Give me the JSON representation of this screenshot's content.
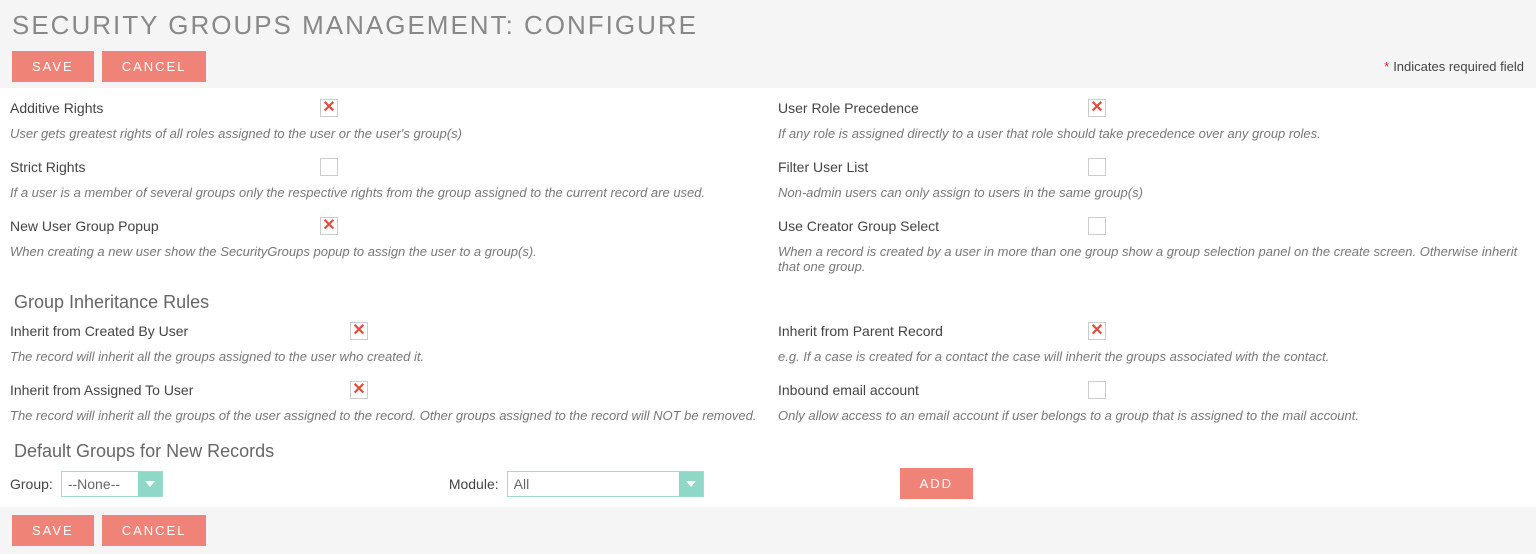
{
  "header": {
    "title": "SECURITY GROUPS MANAGEMENT: CONFIGURE",
    "save": "SAVE",
    "cancel": "CANCEL",
    "required_note": "Indicates required field"
  },
  "left": {
    "additive": {
      "label": "Additive Rights",
      "checked": true,
      "desc": "User gets greatest rights of all roles assigned to the user or the user's group(s)"
    },
    "strict": {
      "label": "Strict Rights",
      "checked": false,
      "desc": "If a user is a member of several groups only the respective rights from the group assigned to the current record are used."
    },
    "popup": {
      "label": "New User Group Popup",
      "checked": true,
      "desc": "When creating a new user show the SecurityGroups popup to assign the user to a group(s)."
    }
  },
  "right": {
    "precedence": {
      "label": "User Role Precedence",
      "checked": true,
      "desc": "If any role is assigned directly to a user that role should take precedence over any group roles."
    },
    "filter": {
      "label": "Filter User List",
      "checked": false,
      "desc": "Non-admin users can only assign to users in the same group(s)"
    },
    "creator": {
      "label": "Use Creator Group Select",
      "checked": false,
      "desc": "When a record is created by a user in more than one group show a group selection panel on the create screen. Otherwise inherit that one group."
    }
  },
  "inherit_title": "Group Inheritance Rules",
  "inherit_left": {
    "created": {
      "label": "Inherit from Created By User",
      "checked": true,
      "desc": "The record will inherit all the groups assigned to the user who created it."
    },
    "assigned": {
      "label": "Inherit from Assigned To User",
      "checked": true,
      "desc": "The record will inherit all the groups of the user assigned to the record. Other groups assigned to the record will NOT be removed."
    }
  },
  "inherit_right": {
    "parent": {
      "label": "Inherit from Parent Record",
      "checked": true,
      "desc": "e.g. If a case is created for a contact the case will inherit the groups associated with the contact."
    },
    "inbound": {
      "label": "Inbound email account",
      "checked": false,
      "desc": "Only allow access to an email account if user belongs to a group that is assigned to the mail account."
    }
  },
  "defaults": {
    "title": "Default Groups for New Records",
    "group_label": "Group:",
    "group_value": "--None--",
    "module_label": "Module:",
    "module_value": "All",
    "add": "ADD"
  }
}
